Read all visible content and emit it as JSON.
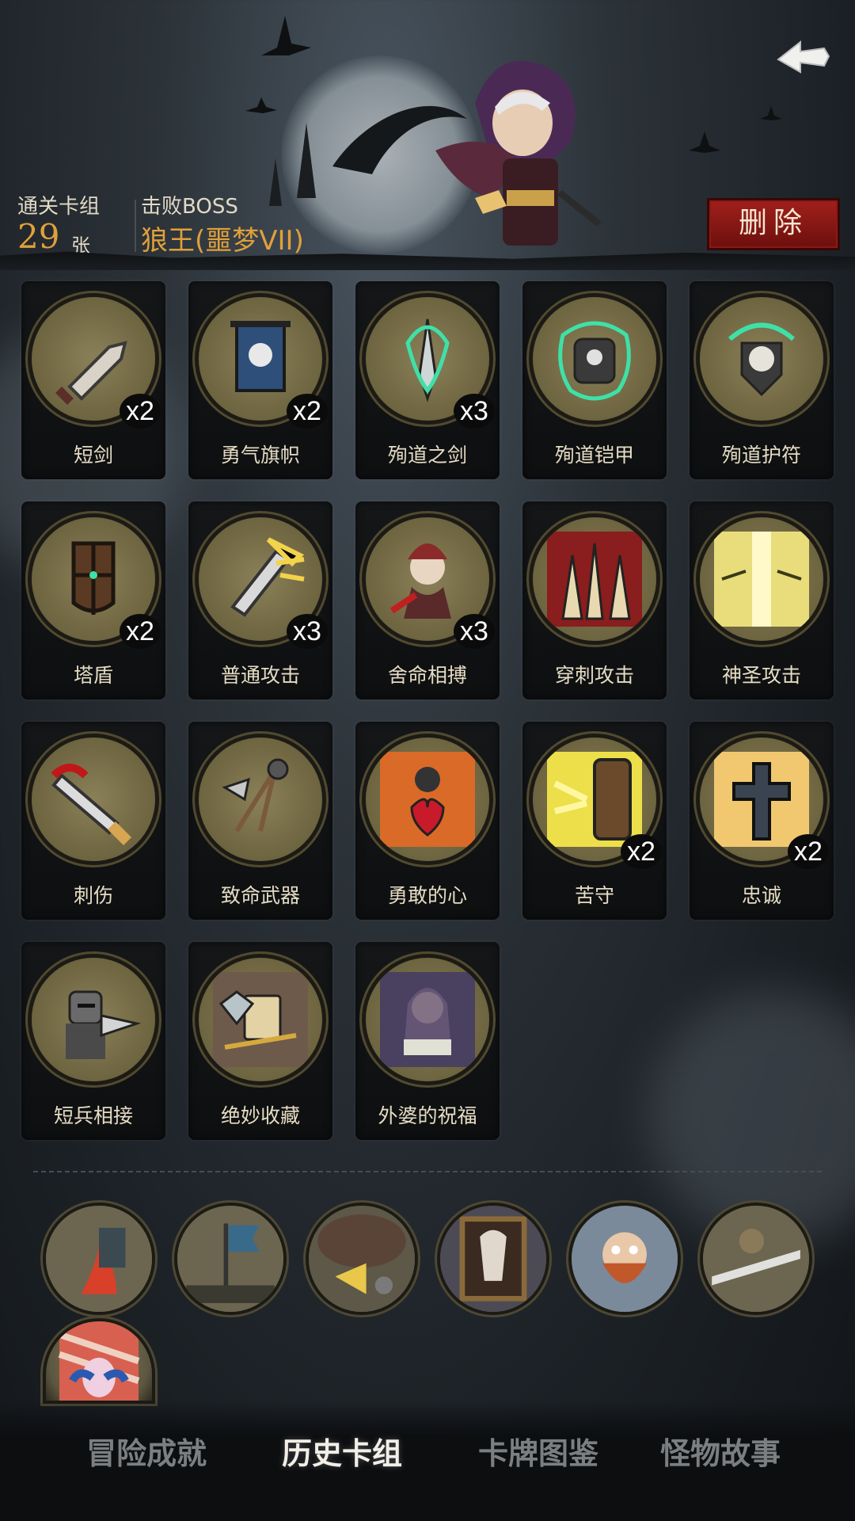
{
  "header": {
    "deck_label": "通关卡组",
    "deck_count": "29",
    "deck_unit": "张",
    "boss_label": "击败BOSS",
    "boss_name": "狼王(噩梦VII)",
    "delete_label": "删除"
  },
  "cards": [
    {
      "name": "短剑",
      "count": "x2",
      "icon": "dagger-icon"
    },
    {
      "name": "勇气旗帜",
      "count": "x2",
      "icon": "skull-banner-icon"
    },
    {
      "name": "殉道之剑",
      "count": "x3",
      "icon": "green-flame-sword-icon"
    },
    {
      "name": "殉道铠甲",
      "count": "",
      "icon": "green-flame-armor-icon"
    },
    {
      "name": "殉道护符",
      "count": "",
      "icon": "green-flame-skull-icon"
    },
    {
      "name": "塔盾",
      "count": "x2",
      "icon": "tower-shield-icon"
    },
    {
      "name": "普通攻击",
      "count": "x3",
      "icon": "sword-strike-icon"
    },
    {
      "name": "舍命相搏",
      "count": "x3",
      "icon": "hooded-fighter-icon"
    },
    {
      "name": "穿刺攻击",
      "count": "",
      "icon": "spikes-icon"
    },
    {
      "name": "神圣攻击",
      "count": "",
      "icon": "holy-light-icon"
    },
    {
      "name": "刺伤",
      "count": "",
      "icon": "bloody-knife-icon"
    },
    {
      "name": "致命武器",
      "count": "",
      "icon": "weapons-icon"
    },
    {
      "name": "勇敢的心",
      "count": "",
      "icon": "brave-heart-icon"
    },
    {
      "name": "苦守",
      "count": "x2",
      "icon": "shield-block-icon"
    },
    {
      "name": "忠诚",
      "count": "x2",
      "icon": "cross-icon"
    },
    {
      "name": "短兵相接",
      "count": "",
      "icon": "knight-icon"
    },
    {
      "name": "绝妙收藏",
      "count": "",
      "icon": "treasure-icon"
    },
    {
      "name": "外婆的祝福",
      "count": "",
      "icon": "grandma-icon"
    }
  ],
  "relics": [
    {
      "icon": "campfire-relic-icon"
    },
    {
      "icon": "banner-army-relic-icon"
    },
    {
      "icon": "cheese-mouse-relic-icon"
    },
    {
      "icon": "painting-relic-icon"
    },
    {
      "icon": "bearded-man-relic-icon"
    },
    {
      "icon": "swordsman-relic-icon"
    },
    {
      "icon": "rabbit-jester-relic-icon"
    }
  ],
  "tabs": [
    {
      "label": "冒险成就",
      "active": false
    },
    {
      "label": "历史卡组",
      "active": true
    },
    {
      "label": "卡牌图鉴",
      "active": false
    },
    {
      "label": "怪物故事",
      "active": false
    }
  ],
  "colors": {
    "accent_gold": "#e0a03a",
    "delete_red": "#a1201b",
    "martyr_green": "#3fe0a8"
  }
}
